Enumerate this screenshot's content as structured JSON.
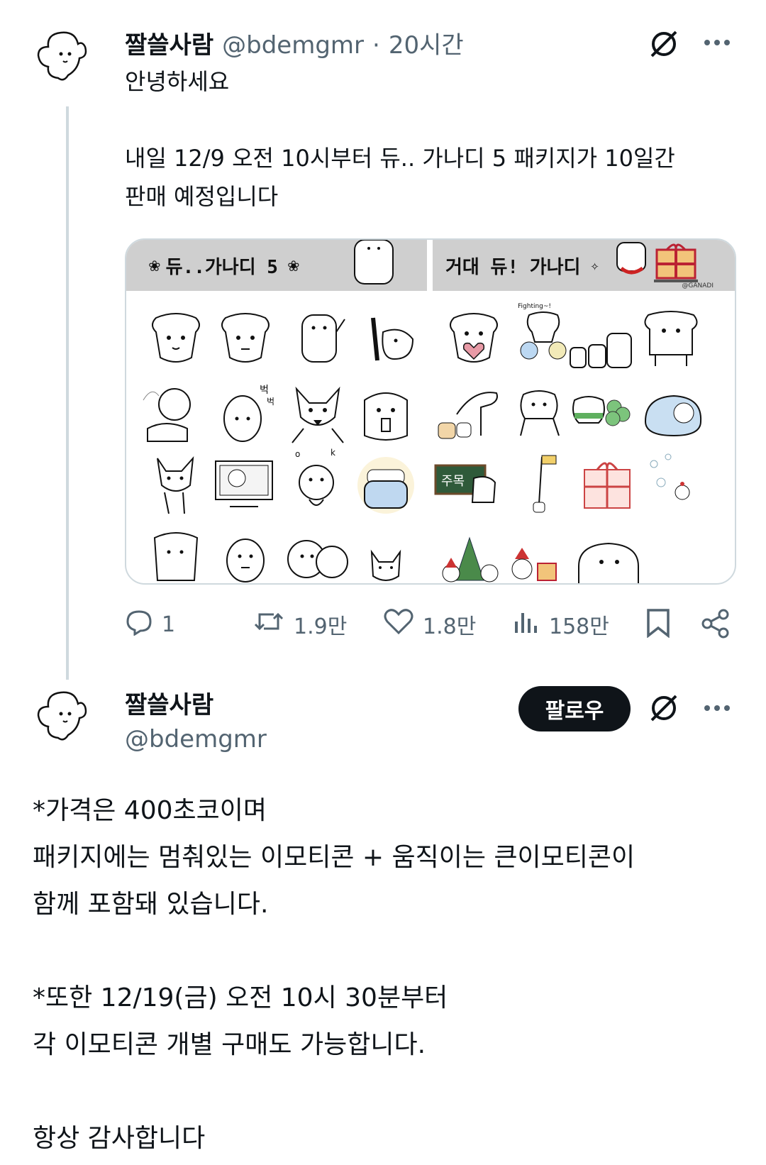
{
  "reply": {
    "author_name": "짤쓸사람",
    "handle": "@bdemgmr",
    "separator": "·",
    "time": "20시간",
    "text": "안녕하세요\n\n내일 12/9 오전 10시부터 듀.. 가나디 5 패키지가 10일간\n판매 예정입니다",
    "media": {
      "left_banner_title": "듀..가나디 5",
      "right_banner_title": "거대 듀! 가나디",
      "watermark": "@GANADI",
      "sticker_captions": [
        "Fighting~!",
        "벅",
        "벅",
        "o",
        "k",
        "주목"
      ]
    },
    "actions": {
      "replies": "1",
      "retweets": "1.9만",
      "likes": "1.8만",
      "views": "158만"
    }
  },
  "main": {
    "author_name": "짤쓸사람",
    "handle": "@bdemgmr",
    "follow_label": "팔로우",
    "text": "*가격은 400초코이며\n패키지에는 멈춰있는 이모티콘 + 움직이는 큰이모티콘이\n함께 포함돼 있습니다.\n\n*또한 12/19(금) 오전 10시 30분부터\n각 이모티콘 개별 구매도 가능합니다.\n\n항상 감사합니다"
  },
  "icons": {
    "grok": "grok-icon",
    "more": "more-icon",
    "reply": "reply-icon",
    "retweet": "retweet-icon",
    "like": "heart-icon",
    "views": "views-icon",
    "bookmark": "bookmark-icon",
    "share": "share-icon"
  },
  "colors": {
    "text": "#0f1419",
    "secondary": "#536471",
    "thread_line": "#cfd9de",
    "banner_gray": "#cfcfcf"
  }
}
